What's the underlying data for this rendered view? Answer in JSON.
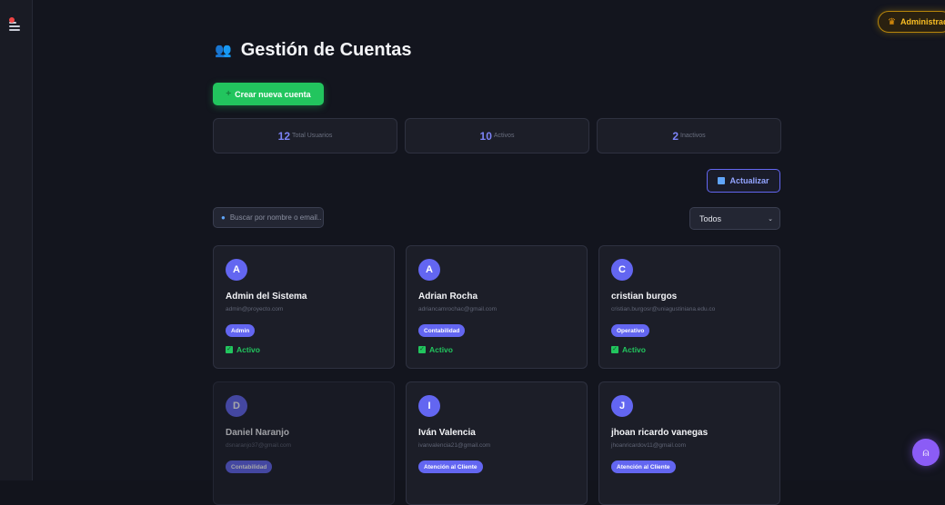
{
  "header": {
    "admin_badge": "Administrador",
    "admin_icon": "crown-icon"
  },
  "page": {
    "title": "Gestión de Cuentas",
    "title_icon": "users-icon"
  },
  "toolbar": {
    "create_label": "Crear nueva cuenta",
    "refresh_label": "Actualizar",
    "search_placeholder": "Buscar por nombre o email...",
    "filter_selected": "Todos"
  },
  "stats": [
    {
      "value": "12",
      "label": "Total Usuarios"
    },
    {
      "value": "10",
      "label": "Activos"
    },
    {
      "value": "2",
      "label": "Inactivos"
    }
  ],
  "users": [
    {
      "initial": "A",
      "name": "Admin del Sistema",
      "email": "admin@proyecto.com",
      "role": "Admin",
      "status": "Activo"
    },
    {
      "initial": "A",
      "name": "Adrian Rocha",
      "email": "adriancamrochac@gmail.com",
      "role": "Contabilidad",
      "status": "Activo"
    },
    {
      "initial": "C",
      "name": "cristian burgos",
      "email": "cristian.burgosr@uniagustiniana.edu.co",
      "role": "Operativo",
      "status": "Activo"
    },
    {
      "initial": "D",
      "name": "Daniel Naranjo",
      "email": "dsnaranjo37@gmail.com",
      "role": "Contabilidad",
      "status": ""
    },
    {
      "initial": "I",
      "name": "Iván Valencia",
      "email": "ivanvalencia21@gmail.com",
      "role": "Atención al Cliente",
      "status": ""
    },
    {
      "initial": "J",
      "name": "jhoan ricardo vanegas",
      "email": "jhoanricardov11@gmail.com",
      "role": "Atención al Cliente",
      "status": ""
    }
  ],
  "colors": {
    "accent": "#6366f1",
    "success": "#22c55e",
    "background": "#13151e",
    "card": "#1c1e28",
    "admin_gold": "#fbbf24"
  }
}
